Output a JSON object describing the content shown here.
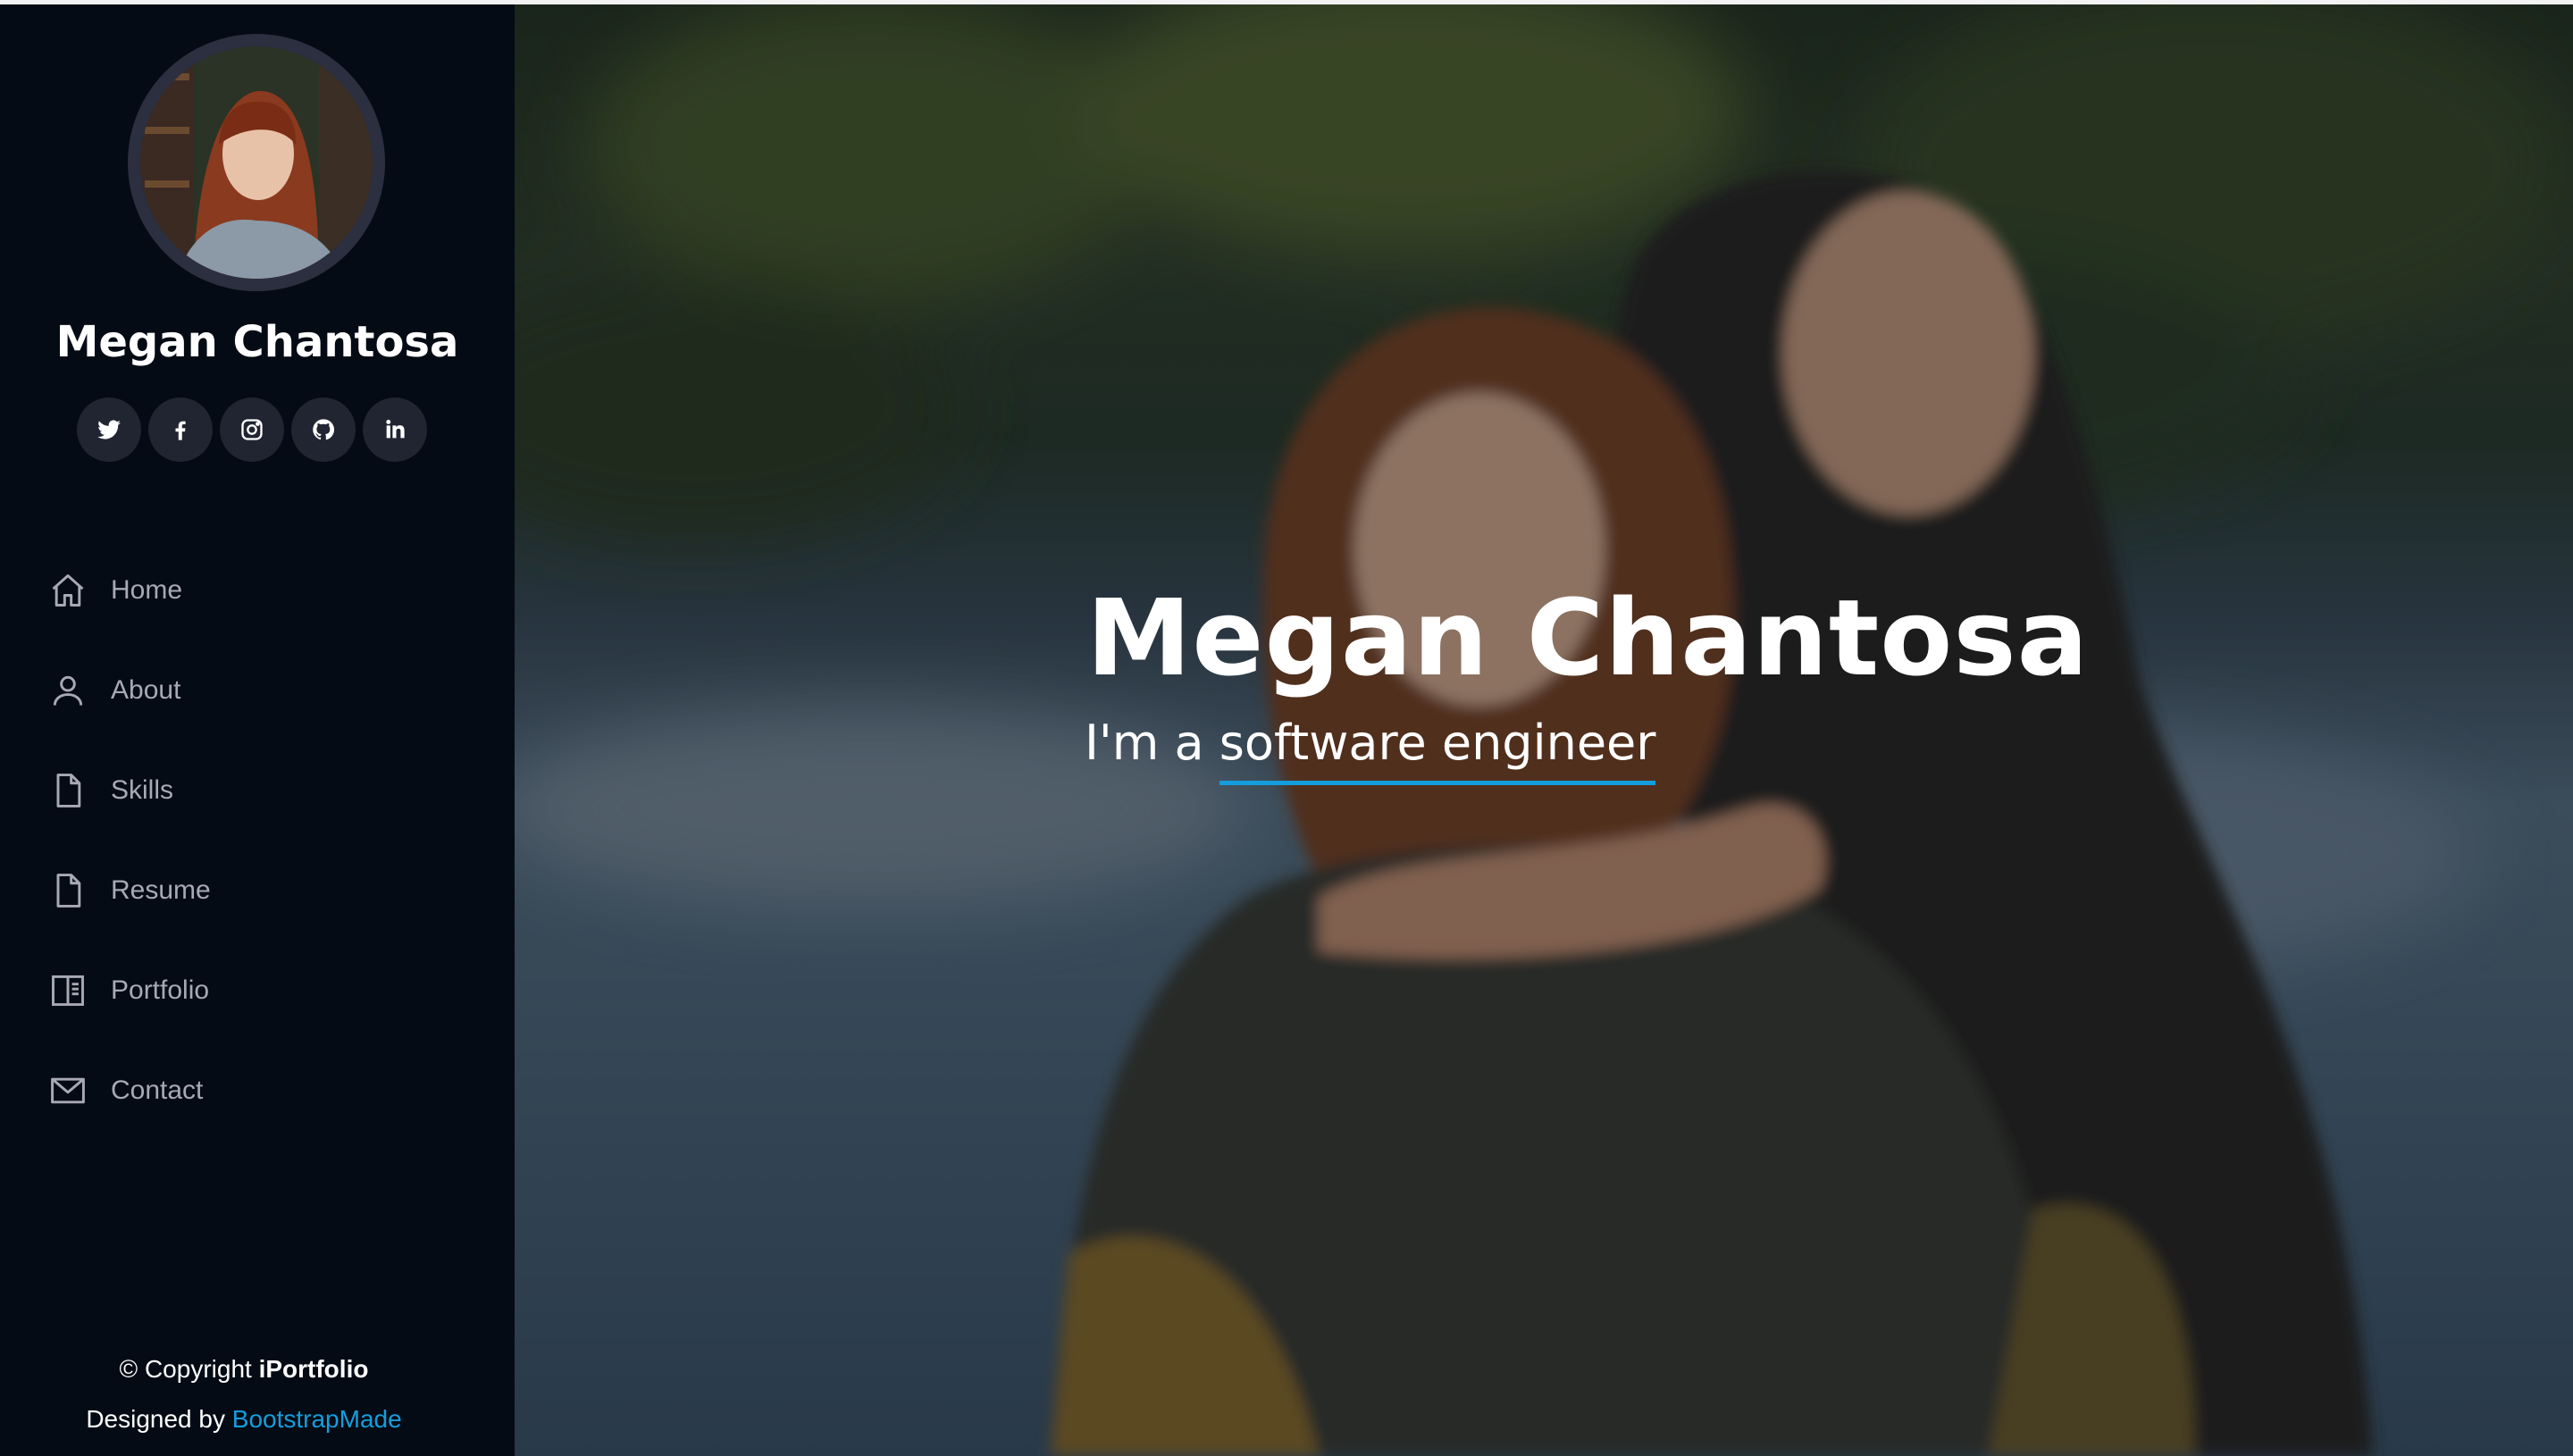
{
  "sidebar": {
    "name": "Megan Chantosa",
    "social": [
      {
        "icon": "twitter-icon"
      },
      {
        "icon": "facebook-icon"
      },
      {
        "icon": "instagram-icon"
      },
      {
        "icon": "github-icon"
      },
      {
        "icon": "linkedin-icon"
      }
    ],
    "nav": [
      {
        "label": "Home",
        "icon": "home-icon"
      },
      {
        "label": "About",
        "icon": "person-icon"
      },
      {
        "label": "Skills",
        "icon": "file-icon"
      },
      {
        "label": "Resume",
        "icon": "file-icon"
      },
      {
        "label": "Portfolio",
        "icon": "book-half-icon"
      },
      {
        "label": "Contact",
        "icon": "envelope-icon"
      }
    ],
    "footer": {
      "copyright_prefix": "© Copyright ",
      "brand": "iPortfolio",
      "designed_prefix": "Designed by ",
      "designer": "BootstrapMade"
    }
  },
  "hero": {
    "title": "Megan Chantosa",
    "subtitle_prefix": "I'm a ",
    "subtitle_typed": "software engineer"
  },
  "colors": {
    "sidebar_bg": "#040b14",
    "accent": "#149ddd",
    "nav_text": "#a8a9b4",
    "social_bg": "#212431"
  }
}
